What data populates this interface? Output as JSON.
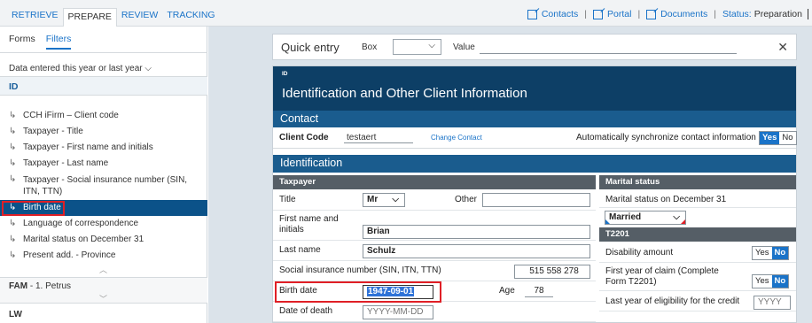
{
  "topnav": {
    "tabs": [
      {
        "label": "RETRIEVE",
        "active": false
      },
      {
        "label": "PREPARE",
        "active": true
      },
      {
        "label": "REVIEW",
        "active": false
      },
      {
        "label": "TRACKING",
        "active": false
      }
    ],
    "links": [
      "Contacts",
      "Portal",
      "Documents"
    ],
    "status_label": "Status:",
    "status_value": "Preparation"
  },
  "left_panel": {
    "tabs": [
      {
        "label": "Forms",
        "active": false
      },
      {
        "label": "Filters",
        "active": true
      }
    ],
    "filter_label": "Data entered this year or last year",
    "section_title": "ID",
    "items": [
      {
        "label": "CCH iFirm – Client code"
      },
      {
        "label": "Taxpayer - Title"
      },
      {
        "label": "Taxpayer - First name and initials"
      },
      {
        "label": "Taxpayer - Last name"
      },
      {
        "label": "Taxpayer - Social insurance number (SIN, ITN, TTN)"
      },
      {
        "label": "Birth date",
        "selected": true
      },
      {
        "label": "Language of correspondence"
      },
      {
        "label": "Marital status on December 31"
      },
      {
        "label": "Present add. - Province"
      }
    ],
    "fam_code": "FAM",
    "fam_label": " - 1. Petrus",
    "lw_label": "LW"
  },
  "quick_entry": {
    "title": "Quick entry",
    "box_label": "Box",
    "value_label": "Value"
  },
  "form": {
    "id_tag": "ID",
    "title": "Identification and Other Client Information",
    "contact_section": "Contact",
    "client_code_label": "Client Code",
    "client_code_value": "testaert",
    "change_contact": "Change Contact",
    "sync_label": "Automatically synchronize contact information",
    "sync_yes": "Yes",
    "sync_no": "No",
    "identification_section": "Identification",
    "taxpayer_header": "Taxpayer",
    "title_label": "Title",
    "title_value": "Mr",
    "other_label": "Other",
    "first_name_label": "First name and initials",
    "first_name_value": "Brian",
    "last_name_label": "Last name",
    "last_name_value": "Schulz",
    "sin_label": "Social insurance number (SIN, ITN, TTN)",
    "sin_value": "515 558 278",
    "birth_label": "Birth date",
    "birth_value": "1947-09-01",
    "age_label": "Age",
    "age_value": "78",
    "death_label": "Date of death",
    "death_placeholder": "YYYY-MM-DD",
    "marital_header": "Marital status",
    "marital_label": "Marital status on December 31",
    "marital_value": "Married",
    "t2201_header": "T2201",
    "disability_label": "Disability amount",
    "first_year_label": "First year of claim (Complete Form T2201)",
    "last_year_label": "Last year of eligibility for the credit",
    "last_year_placeholder": "YYYY",
    "yes": "Yes",
    "no": "No"
  },
  "colors": {
    "accent": "#1a73c8",
    "header_dark": "#0d3f66",
    "section_band": "#1a5c8e",
    "selected_row": "#0b5289",
    "highlight_red": "#e01f26"
  }
}
